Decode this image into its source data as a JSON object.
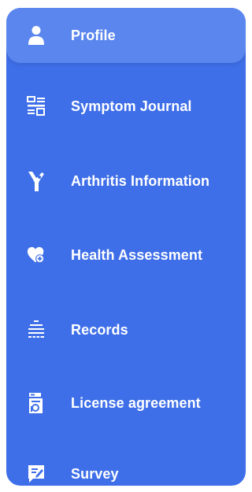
{
  "menu": {
    "accent_color": "#3f6fe8",
    "active_color": "#5a86ee",
    "items": [
      {
        "label": "Profile",
        "icon": "user-icon",
        "active": true
      },
      {
        "label": "Symptom Journal",
        "icon": "journal-list-icon",
        "active": false
      },
      {
        "label": "Arthritis Information",
        "icon": "joint-bone-icon",
        "active": false
      },
      {
        "label": "Health Assessment",
        "icon": "heart-plus-icon",
        "active": false
      },
      {
        "label": "Records",
        "icon": "records-list-icon",
        "active": false
      },
      {
        "label": "License agreement",
        "icon": "license-document-icon",
        "active": false
      },
      {
        "label": "Survey",
        "icon": "survey-edit-icon",
        "active": false
      }
    ]
  }
}
